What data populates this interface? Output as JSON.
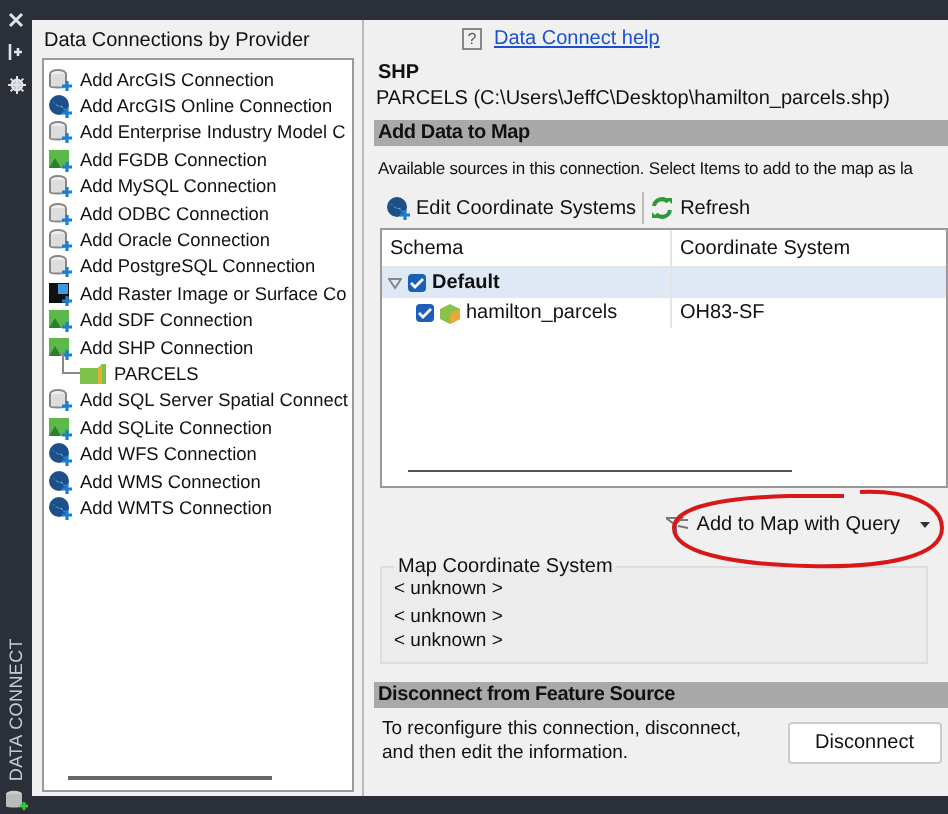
{
  "side_strip": {
    "title": "DATA CONNECT"
  },
  "providers": {
    "title": "Data Connections by Provider",
    "items": [
      {
        "label": "Add ArcGIS Connection",
        "kind": "database"
      },
      {
        "label": "Add ArcGIS Online Connection",
        "kind": "globe"
      },
      {
        "label": "Add Enterprise Industry Model C",
        "kind": "database"
      },
      {
        "label": "Add FGDB Connection",
        "kind": "file"
      },
      {
        "label": "Add MySQL Connection",
        "kind": "database"
      },
      {
        "label": "Add ODBC Connection",
        "kind": "database"
      },
      {
        "label": "Add Oracle Connection",
        "kind": "database"
      },
      {
        "label": "Add PostgreSQL Connection",
        "kind": "database"
      },
      {
        "label": "Add Raster Image or Surface Co",
        "kind": "raster"
      },
      {
        "label": "Add SDF Connection",
        "kind": "file"
      },
      {
        "label": "Add SHP Connection",
        "kind": "file",
        "children": [
          {
            "label": "PARCELS",
            "kind": "layer"
          }
        ]
      },
      {
        "label": "Add SQL Server Spatial Connect",
        "kind": "database"
      },
      {
        "label": "Add SQLite Connection",
        "kind": "file"
      },
      {
        "label": "Add WFS Connection",
        "kind": "globe"
      },
      {
        "label": "Add WMS Connection",
        "kind": "globe"
      },
      {
        "label": "Add WMTS Connection",
        "kind": "globe"
      }
    ]
  },
  "help_icon": "?",
  "help_link": "Data Connect help",
  "connection": {
    "type": "SHP",
    "path": "PARCELS (C:\\Users\\JeffC\\Desktop\\hamilton_parcels.shp)"
  },
  "add_data": {
    "header": "Add Data to Map",
    "description": "Available sources in this connection.  Select Items to add to the map as la",
    "toolbar": [
      {
        "label": "Edit Coordinate Systems",
        "kind": "globe"
      },
      {
        "label": "Refresh",
        "kind": "refresh"
      }
    ],
    "columns": [
      "Schema",
      "Coordinate System"
    ],
    "tree": [
      {
        "label": "Default",
        "checked": true,
        "expanded": true,
        "selected": true,
        "children": [
          {
            "label": "hamilton_parcels",
            "checked": true,
            "selected": false,
            "coordinate_system": "OH83-SF"
          }
        ]
      }
    ],
    "query_button": {
      "label": "Add to Map with Query",
      "annotated": true
    }
  },
  "map_coordinate_system": {
    "title": "Map Coordinate System",
    "values": [
      "< unknown >",
      "< unknown >",
      "< unknown >"
    ]
  },
  "disconnect": {
    "header": "Disconnect from Feature Source",
    "text": "To reconfigure this connection, disconnect, and then edit the information.",
    "button": "Disconnect"
  }
}
